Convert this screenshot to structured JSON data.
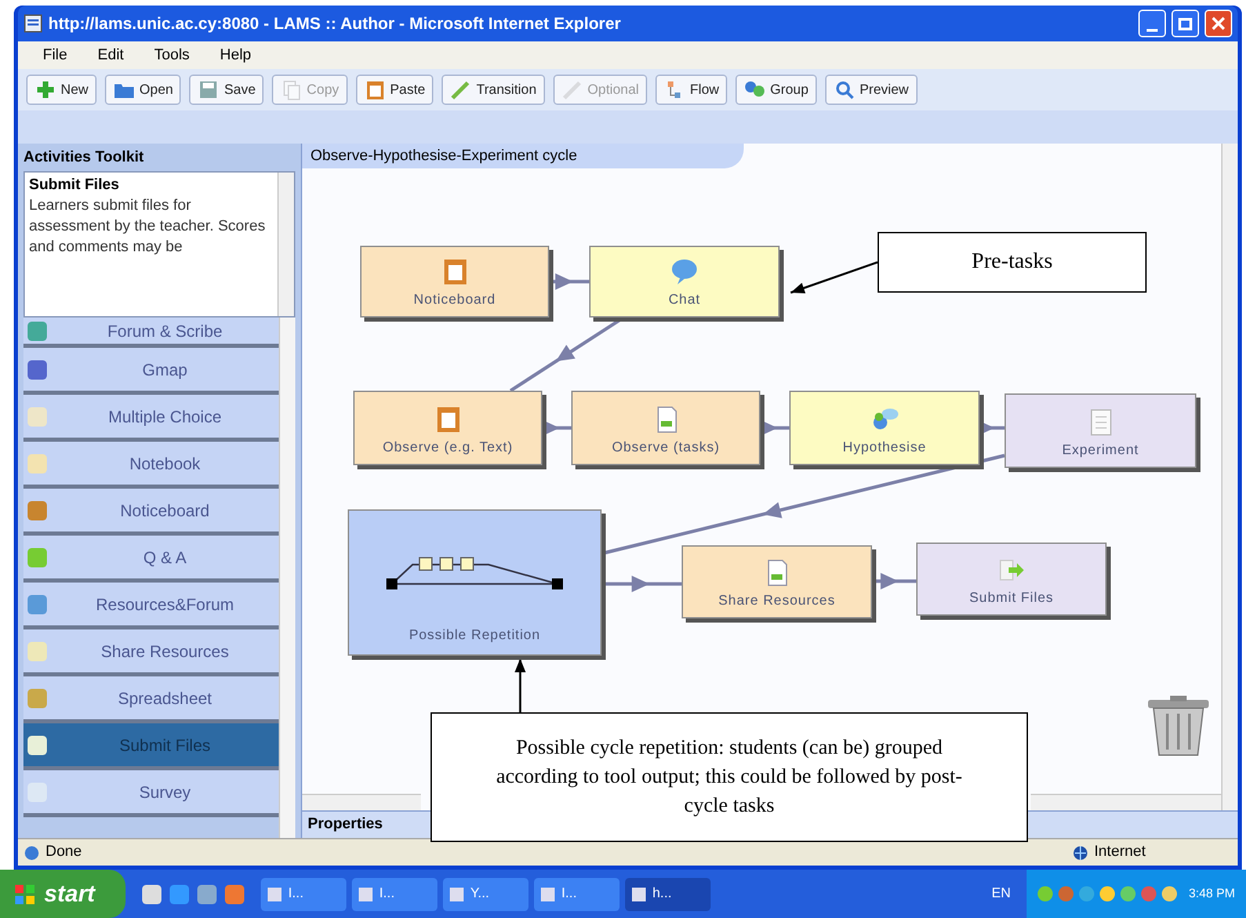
{
  "window": {
    "title": "http://lams.unic.ac.cy:8080 - LAMS :: Author - Microsoft Internet Explorer"
  },
  "menu": [
    "File",
    "Edit",
    "Tools",
    "Help"
  ],
  "toolbar": [
    {
      "label": "New",
      "disabled": false
    },
    {
      "label": "Open",
      "disabled": false
    },
    {
      "label": "Save",
      "disabled": false
    },
    {
      "label": "Copy",
      "disabled": true
    },
    {
      "label": "Paste",
      "disabled": false
    },
    {
      "label": "Transition",
      "disabled": false
    },
    {
      "label": "Optional",
      "disabled": true
    },
    {
      "label": "Flow",
      "disabled": false
    },
    {
      "label": "Group",
      "disabled": false
    },
    {
      "label": "Preview",
      "disabled": false
    }
  ],
  "toolkit": {
    "title": "Activities Toolkit",
    "description_title": "Submit Files",
    "description": "Learners submit files for assessment by the teacher. Scores and comments may be",
    "items": [
      {
        "label": "Forum & Scribe",
        "selected": false
      },
      {
        "label": "Gmap",
        "selected": false
      },
      {
        "label": "Multiple Choice",
        "selected": false
      },
      {
        "label": "Notebook",
        "selected": false
      },
      {
        "label": "Noticeboard",
        "selected": false
      },
      {
        "label": "Q & A",
        "selected": false
      },
      {
        "label": "Resources&Forum",
        "selected": false
      },
      {
        "label": "Share Resources",
        "selected": false
      },
      {
        "label": "Spreadsheet",
        "selected": false
      },
      {
        "label": "Submit Files",
        "selected": true
      },
      {
        "label": "Survey",
        "selected": false
      }
    ]
  },
  "canvas": {
    "tab": "Observe-Hypothesise-Experiment cycle",
    "nodes": [
      {
        "kind": "activity",
        "label": "Noticeboard",
        "color": "#fbe3bd"
      },
      {
        "kind": "activity",
        "label": "Chat",
        "color": "#fdfbc2"
      },
      {
        "kind": "activity",
        "label": "Observe (e.g. Text)",
        "color": "#fbe3bd"
      },
      {
        "kind": "activity",
        "label": "Observe (tasks)",
        "color": "#fbe3bd"
      },
      {
        "kind": "activity",
        "label": "Hypothesise",
        "color": "#fdfbc2"
      },
      {
        "kind": "activity",
        "label": "Experiment",
        "color": "#e6e1f3"
      },
      {
        "kind": "group",
        "label": "Possible Repetition",
        "color": "#b9cdf6"
      },
      {
        "kind": "activity",
        "label": "Share Resources",
        "color": "#fbe3bd"
      },
      {
        "kind": "activity",
        "label": "Submit Files",
        "color": "#e6e1f3"
      }
    ],
    "callouts": [
      "Pre-tasks",
      "Possible cycle repetition: students (can be) grouped according to tool output; this could be followed by post-cycle tasks"
    ]
  },
  "properties": "Properties",
  "status_bar": {
    "text": "Done",
    "zone": "Internet"
  },
  "taskbar": {
    "start": "start",
    "tasks": [
      {
        "label": "I...",
        "selected": false
      },
      {
        "label": "I...",
        "selected": false
      },
      {
        "label": "Y...",
        "selected": false
      },
      {
        "label": "I...",
        "selected": false
      },
      {
        "label": "h...",
        "selected": true
      }
    ],
    "language": "EN",
    "clock": "3:48 PM"
  }
}
